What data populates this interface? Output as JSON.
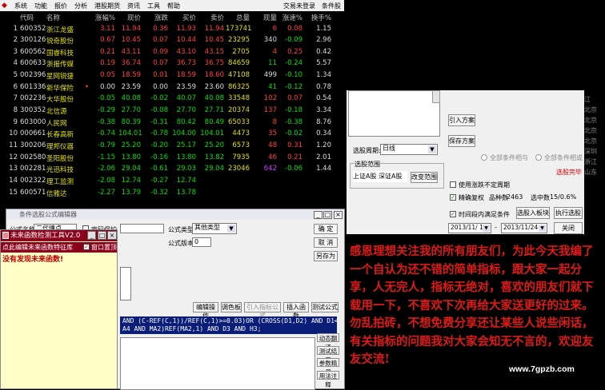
{
  "menubar": {
    "items": [
      "系统",
      "功能",
      "报价",
      "分析",
      "港股期货",
      "资讯",
      "工具",
      "帮助"
    ],
    "right": [
      "交易未登录",
      "条件股"
    ]
  },
  "quote": {
    "headers": [
      "代码",
      "名称",
      "涨幅%",
      "现价",
      "涨跌",
      "买价",
      "卖价",
      "总量",
      "现量",
      "涨速%",
      "换手%"
    ],
    "rows": [
      {
        "idx": "1",
        "code": "600352",
        "name": "浙江龙盛",
        "mark": "",
        "pct": "3.11",
        "price": "11.94",
        "chg": "0.36",
        "bid": "11.93",
        "ask": "11.94",
        "vol": "173741",
        "cur": "6",
        "spd": "0.08",
        "turn": "1.15",
        "dir": "up",
        "curc": "up",
        "spdc": "up"
      },
      {
        "idx": "2",
        "code": "300126",
        "name": "锐奇股份",
        "mark": "",
        "pct": "0.67",
        "price": "10.45",
        "chg": "0.07",
        "bid": "10.44",
        "ask": "10.45",
        "vol": "23295",
        "cur": "340",
        "spd": "-0.09",
        "turn": "2.96",
        "dir": "up",
        "curc": "wh",
        "spdc": "dn"
      },
      {
        "idx": "3",
        "code": "600562",
        "name": "国睿科技",
        "mark": "",
        "pct": "0.21",
        "price": "43.11",
        "chg": "0.09",
        "bid": "43.10",
        "ask": "43.15",
        "vol": "2705",
        "cur": "4",
        "spd": "0.25",
        "turn": "0.42",
        "dir": "up",
        "curc": "up",
        "spdc": "up"
      },
      {
        "idx": "4",
        "code": "600633",
        "name": "浙报传媒",
        "mark": "",
        "pct": "0.19",
        "price": "36.74",
        "chg": "0.07",
        "bid": "36.73",
        "ask": "36.75",
        "vol": "84659",
        "cur": "11",
        "spd": "-0.24",
        "turn": "5.57",
        "dir": "up",
        "curc": "dn",
        "spdc": "dn"
      },
      {
        "idx": "5",
        "code": "002396",
        "name": "星网锐捷",
        "mark": "",
        "pct": "0.05",
        "price": "18.59",
        "chg": "0.01",
        "bid": "18.59",
        "ask": "18.60",
        "vol": "47108",
        "cur": "499",
        "spd": "-0.10",
        "turn": "1.34",
        "dir": "up",
        "curc": "wh",
        "spdc": "dn"
      },
      {
        "idx": "6",
        "code": "601336",
        "name": "新华保险",
        "mark": "•",
        "pct": "0.00",
        "price": "23.59",
        "chg": "0.00",
        "bid": "23.59",
        "ask": "23.60",
        "vol": "86325",
        "cur": "41",
        "spd": "-0.12",
        "turn": "0.78",
        "dir": "wh",
        "curc": "dn",
        "spdc": "dn"
      },
      {
        "idx": "7",
        "code": "002236",
        "name": "大华股份",
        "mark": "",
        "pct": "-0.05",
        "price": "40.08",
        "chg": "-0.02",
        "bid": "40.07",
        "ask": "40.08",
        "vol": "33548",
        "cur": "102",
        "spd": "0.07",
        "turn": "0.54",
        "dir": "dn",
        "curc": "up",
        "spdc": "up"
      },
      {
        "idx": "8",
        "code": "300352",
        "name": "北信源",
        "mark": "",
        "pct": "-0.29",
        "price": "27.70",
        "chg": "-0.08",
        "bid": "27.70",
        "ask": "27.71",
        "vol": "20374",
        "cur": "137",
        "spd": "-0.18",
        "turn": "3.34",
        "dir": "dn",
        "curc": "up",
        "spdc": "dn"
      },
      {
        "idx": "9",
        "code": "603000",
        "name": "人民网",
        "mark": "",
        "pct": "-0.38",
        "price": "80.39",
        "chg": "-0.31",
        "bid": "80.42",
        "ask": "80.49",
        "vol": "65033",
        "cur": "8",
        "spd": "-0.38",
        "turn": "8.76",
        "dir": "dn",
        "curc": "up",
        "spdc": "dn"
      },
      {
        "idx": "10",
        "code": "000661",
        "name": "长春高新",
        "mark": "",
        "pct": "-0.74",
        "price": "104.01",
        "chg": "-0.78",
        "bid": "104.00",
        "ask": "104.01",
        "vol": "4473",
        "cur": "35",
        "spd": "-0.02",
        "turn": "0.34",
        "dir": "dn",
        "curc": "up",
        "spdc": "dn"
      },
      {
        "idx": "11",
        "code": "300206",
        "name": "理邦仪器",
        "mark": "",
        "pct": "-0.79",
        "price": "25.20",
        "chg": "-0.20",
        "bid": "25.17",
        "ask": "25.20",
        "vol": "6573",
        "cur": "48",
        "spd": "0.31",
        "turn": "1.20",
        "dir": "dn",
        "curc": "up",
        "spdc": "up"
      },
      {
        "idx": "12",
        "code": "002580",
        "name": "圣阳股份",
        "mark": "",
        "pct": "-1.15",
        "price": "13.80",
        "chg": "-0.16",
        "bid": "13.80",
        "ask": "13.82",
        "vol": "7935",
        "cur": "46",
        "spd": "0.21",
        "turn": "2.01",
        "dir": "dn",
        "curc": "up",
        "spdc": "up"
      },
      {
        "idx": "13",
        "code": "002281",
        "name": "光迅科技",
        "mark": "",
        "pct": "-2.06",
        "price": "29.04",
        "chg": "-0.61",
        "bid": "29.03",
        "ask": "29.04",
        "vol": "23046",
        "cur": "642",
        "spd": "-0.06",
        "turn": "1.44",
        "dir": "dn",
        "curc": "pu",
        "spdc": "dn"
      },
      {
        "idx": "14",
        "code": "002322",
        "name": "理工监测",
        "mark": "",
        "pct": "-2.08",
        "price": "12.74",
        "chg": "-0.27",
        "bid": "12.74",
        "ask": "",
        "vol": "",
        "cur": "",
        "spd": "",
        "turn": "",
        "dir": "dn",
        "curc": "wh",
        "spdc": "wh"
      },
      {
        "idx": "15",
        "code": "600571",
        "name": "信雅达",
        "mark": "",
        "pct": "-2.27",
        "price": "13.79",
        "chg": "-0.32",
        "bid": "13.78",
        "ask": "",
        "vol": "",
        "cur": "",
        "spd": "",
        "turn": "",
        "dir": "dn",
        "curc": "wh",
        "spdc": "wh"
      }
    ]
  },
  "editor": {
    "title": "条件选股公式编辑器",
    "name_label": "公式名称",
    "name_value": "二代缠点",
    "pwd_label": "密码保护",
    "type_label": "公式类型",
    "type_value": "其他类型",
    "ver_label": "公式版本",
    "ver_value": "0",
    "confirm": "确  定",
    "cancel": "取  消",
    "saveas": "另存为",
    "toolbar": [
      "编辑操作",
      "调色板",
      "引入指标公式",
      "插入函数",
      "测试公式"
    ],
    "code": [
      "AND (C-REF(C,1))/REF(C,1)>=0.03)OR (CROSS(D1,D2) AND D1<=-0.",
      "A4 AND MA2)REF(MA2,1)  AND D3 AND H3;"
    ],
    "side_buttons": [
      "动态翻译",
      "测试结果",
      "参数精灵",
      "用法注释"
    ]
  },
  "fw": {
    "title": "未来函数检测工具V2.0",
    "hint": "点此编辑未来函数特征库",
    "check_label": "窗口置顶",
    "result": "没有发现未来函数!"
  },
  "selpanel": {
    "intro_btn": "引入方案",
    "save_btn": "保存方案",
    "period_label": "选股周期:",
    "period_value": "日线",
    "range_label": "选股范围",
    "range_items": "上证A股  深证A股",
    "change_btn": "改变范围",
    "radio1": "全部条件相与",
    "radio2": "全部条件相或",
    "done": "选股完毕",
    "opt1": "使用涨跌不定周期",
    "opt2": "精确复权",
    "count_label": "品种数",
    "count": "2463",
    "sel_label": "选中数",
    "sel": "15/0.6%",
    "opt3": "时间段内满足条件",
    "btn_into": "选股入板块",
    "btn_exec": "执行选股",
    "date1": "2013/11/ 1",
    "date2": "2013/11/24",
    "close": "关闭"
  },
  "side_chars": [
    "江",
    "北京",
    "北京",
    "北京",
    "北京",
    "深圳",
    "浙江",
    "山东"
  ],
  "message": "感恩理想关注我的所有朋友们，为此今天我编了一个自认为还不错的简单指标，跟大家一起分享，人无完人，指标无绝对，喜欢的朋友们就下载用一下，不喜欢下次再给大家送更好的过来。勿乱拍砖，不想免费分享还让某些人说些闲话，有关指标的问题我对大家会知无不言的，欢迎友友交流!",
  "watermark": "www.7gpzb.com"
}
